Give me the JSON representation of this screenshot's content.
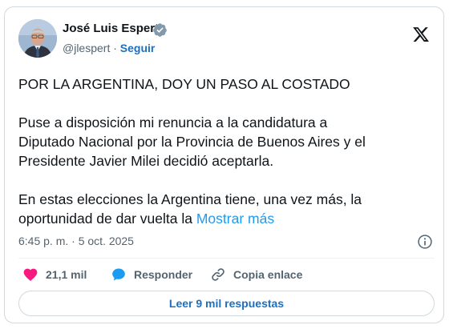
{
  "author": {
    "name": "José Luis Espert",
    "handle": "@jlespert",
    "separator": "·",
    "follow_label": "Seguir",
    "verified_color": "#829aab",
    "avatar_icon": "avatar-photo"
  },
  "brand": {
    "logo_icon": "x-logo"
  },
  "tweet": {
    "paragraphs": [
      "POR LA ARGENTINA, DOY UN PASO AL COSTADO",
      "Puse a disposición mi renuncia a la candidatura a",
      "Diputado Nacional por la Provincia de Buenos Aires y el",
      "Presidente Javier Milei decidió aceptarla.",
      "En estas elecciones la Argentina tiene, una vez más, la",
      "oportunidad de dar vuelta la"
    ],
    "show_more_label": "Mostrar más",
    "timestamp": "6:45 p. m. · 5 oct. 2025"
  },
  "actions": {
    "like_count": "21,1 mil",
    "reply_label": "Responder",
    "copy_link_label": "Copia enlace"
  },
  "footer": {
    "read_replies_label": "Leer 9 mil respuestas"
  },
  "colors": {
    "like": "#f91880",
    "reply": "#1d9bf0",
    "link": "#1d6fbf",
    "muted": "#536471",
    "border": "#cfd9de"
  }
}
